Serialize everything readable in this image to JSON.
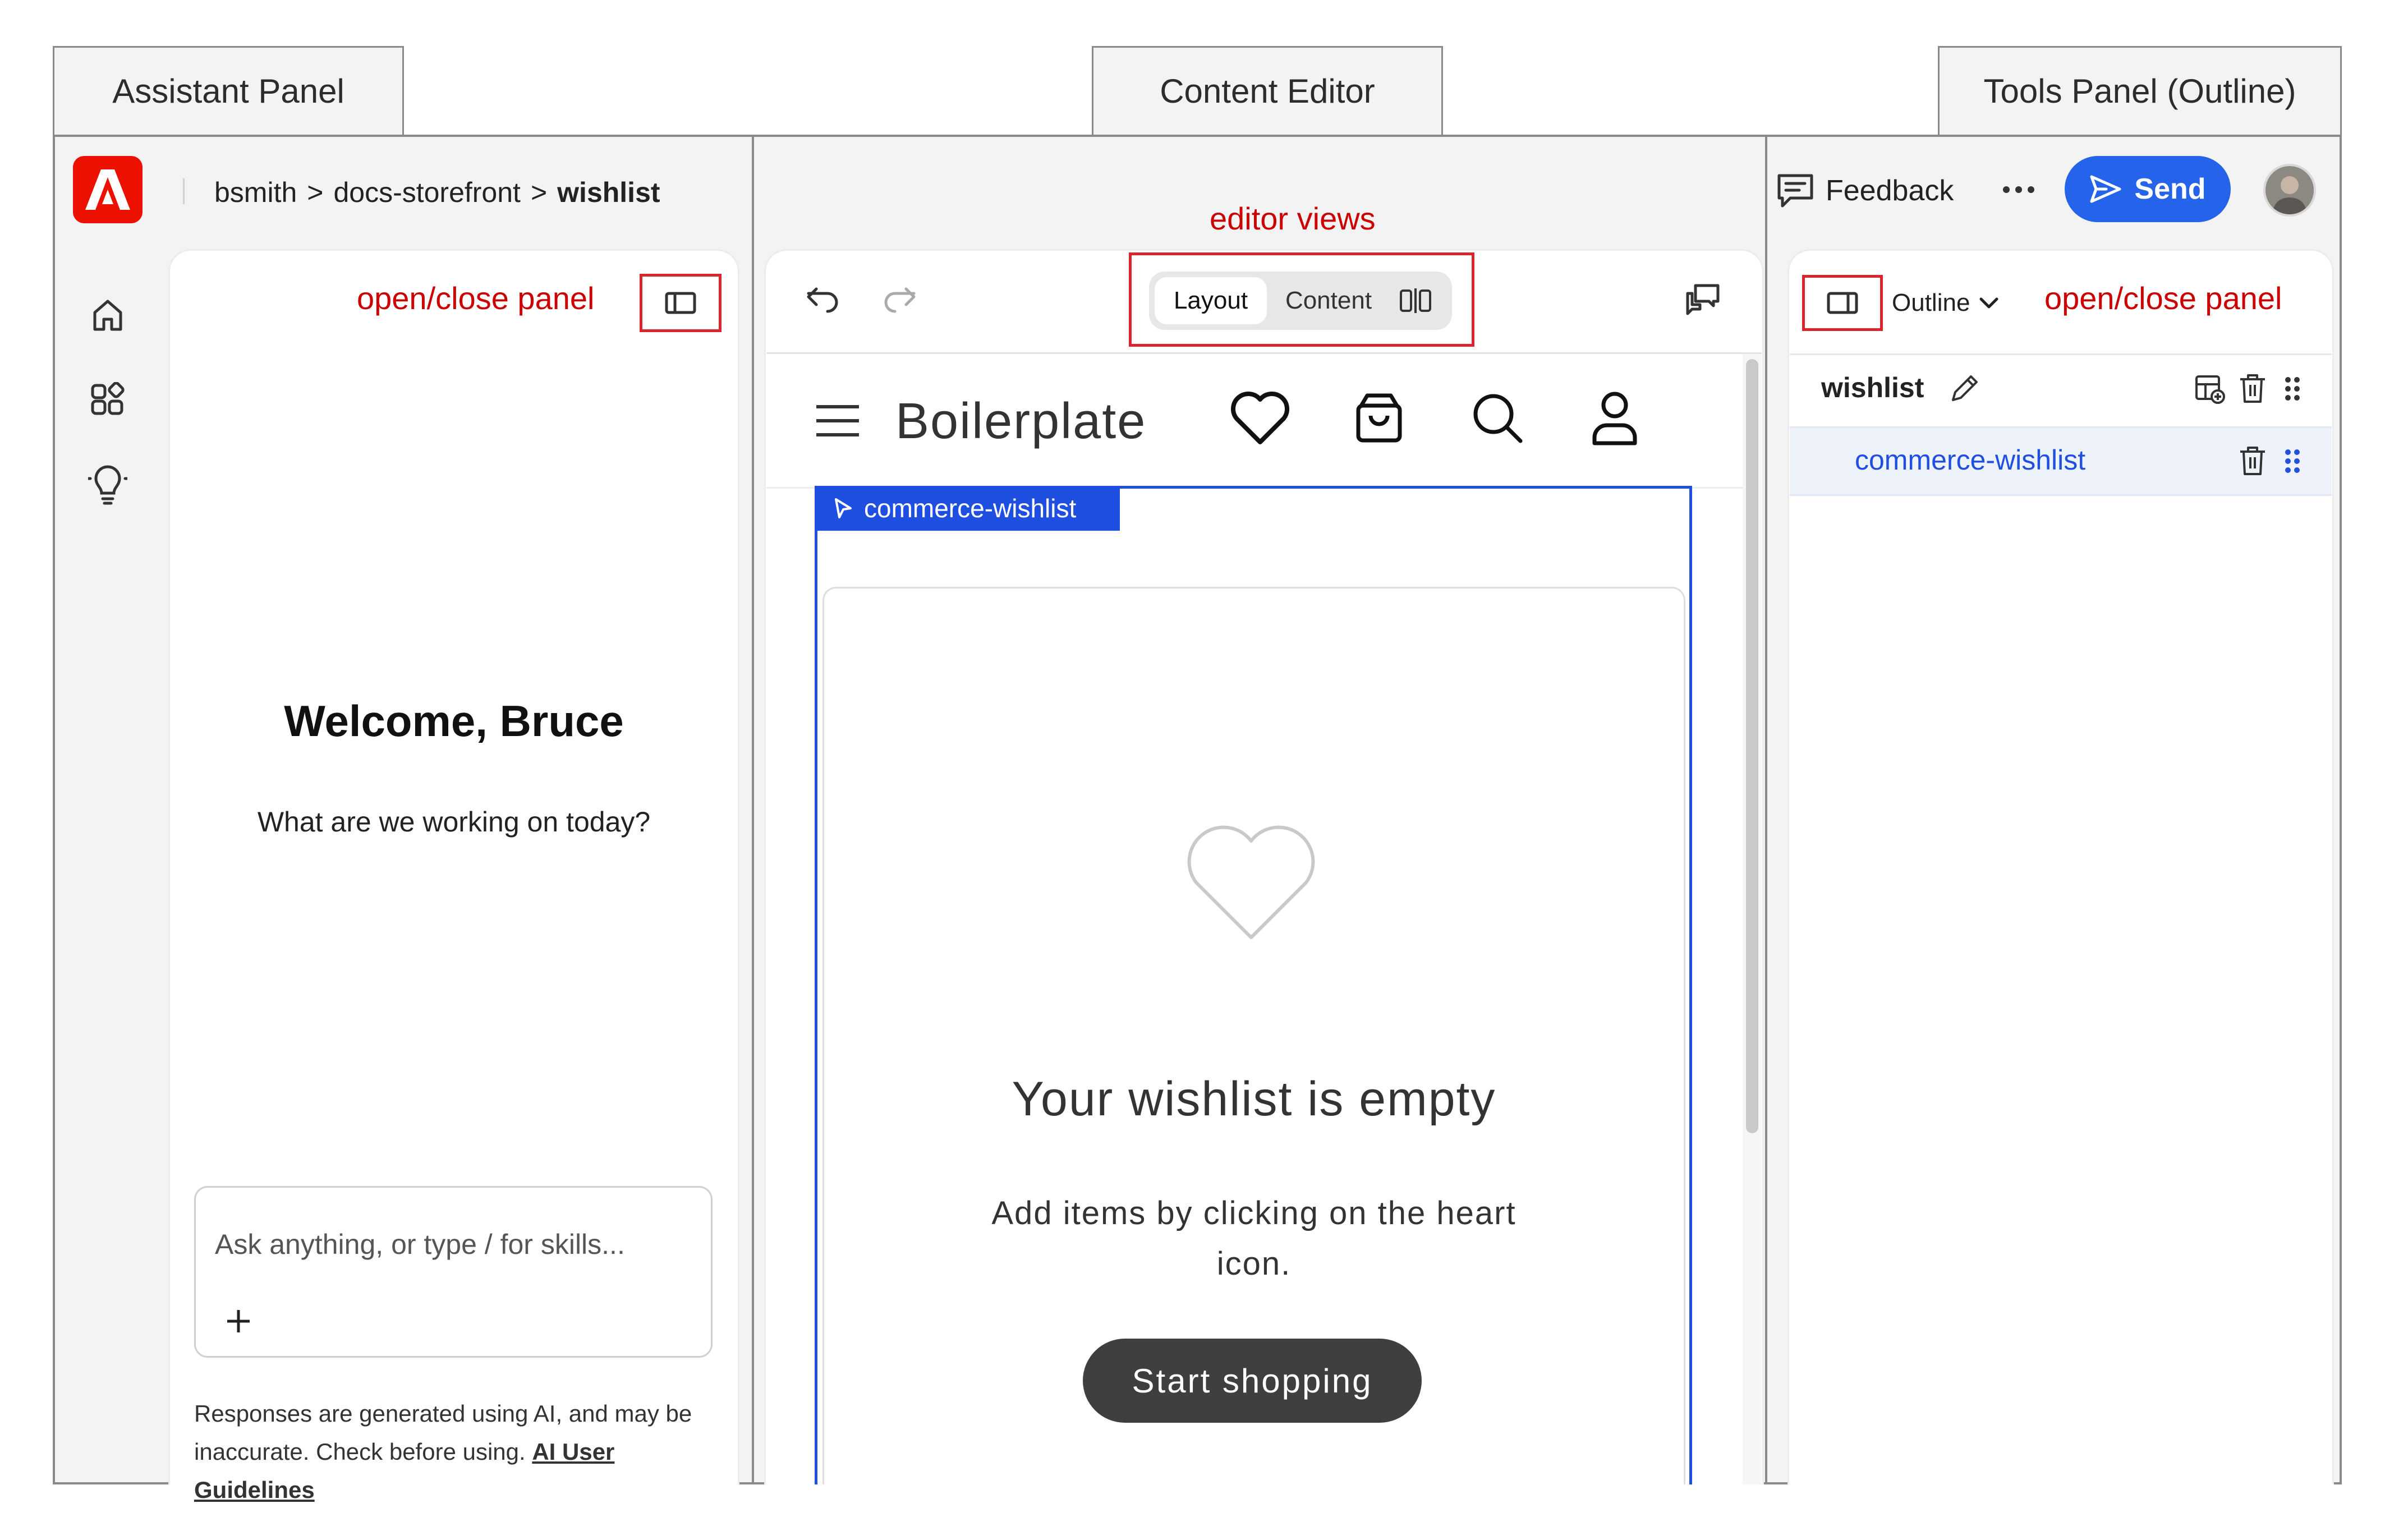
{
  "labels": {
    "assistant_panel": "Assistant Panel",
    "content_editor": "Content Editor",
    "tools_panel": "Tools Panel (Outline)"
  },
  "annotations": {
    "open_close_left": "open/close panel",
    "editor_views": "editor views",
    "open_close_right": "open/close panel"
  },
  "breadcrumb": {
    "items": [
      "bsmith",
      "docs-storefront",
      "wishlist"
    ],
    "separator": ">"
  },
  "assistant": {
    "welcome": "Welcome, Bruce",
    "prompt": "What are we working on today?",
    "input_placeholder": "Ask anything, or type / for skills...",
    "disclaimer": "Responses are generated using AI, and may be inaccurate. Check before using.",
    "disclaimer_link": "AI User Guidelines"
  },
  "editor": {
    "views": [
      "Layout",
      "Content"
    ],
    "active_view": "Layout",
    "site_title": "Boilerplate",
    "block_label": "commerce-wishlist",
    "empty_title": "Your wishlist is empty",
    "empty_text": "Add items by clicking on the heart icon.",
    "cta": "Start shopping"
  },
  "tools": {
    "feedback": "Feedback",
    "send": "Send",
    "outline_label": "Outline",
    "tree": [
      {
        "label": "wishlist",
        "level": 0
      },
      {
        "label": "commerce-wishlist",
        "level": 1
      }
    ]
  },
  "colors": {
    "accent_blue": "#2563eb",
    "annotation_red": "#cc0000",
    "adobe_red": "#eb1000"
  }
}
